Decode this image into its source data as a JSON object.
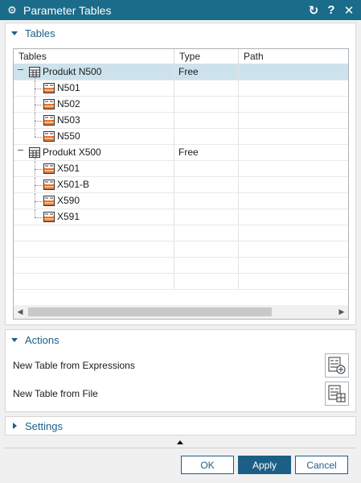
{
  "window": {
    "title": "Parameter Tables",
    "controls": [
      "reset-icon",
      "help-icon",
      "close-icon"
    ]
  },
  "tables_group": {
    "label": "Tables",
    "columns": [
      "Tables",
      "Type",
      "Path"
    ],
    "rows": [
      {
        "label": "Produkt N500",
        "type": "Free",
        "path": "",
        "level": 0,
        "selected": true
      },
      {
        "label": "N501",
        "type": "",
        "path": "",
        "level": 1
      },
      {
        "label": "N502",
        "type": "",
        "path": "",
        "level": 1
      },
      {
        "label": "N503",
        "type": "",
        "path": "",
        "level": 1
      },
      {
        "label": "N550",
        "type": "",
        "path": "",
        "level": 1
      },
      {
        "label": "Produkt X500",
        "type": "Free",
        "path": "",
        "level": 0
      },
      {
        "label": "X501",
        "type": "",
        "path": "",
        "level": 1
      },
      {
        "label": "X501-B",
        "type": "",
        "path": "",
        "level": 1
      },
      {
        "label": "X590",
        "type": "",
        "path": "",
        "level": 1
      },
      {
        "label": "X591",
        "type": "",
        "path": "",
        "level": 1
      }
    ]
  },
  "actions_group": {
    "label": "Actions",
    "items": [
      {
        "label": "New Table from Expressions",
        "icon": "table-add-icon"
      },
      {
        "label": "New Table from File",
        "icon": "table-import-icon"
      }
    ]
  },
  "settings_group": {
    "label": "Settings"
  },
  "buttons": {
    "ok": "OK",
    "apply": "Apply",
    "cancel": "Cancel"
  },
  "colors": {
    "titlebar": "#1b6b8a",
    "accent": "#1b5f86",
    "selection": "#cce3ed"
  }
}
